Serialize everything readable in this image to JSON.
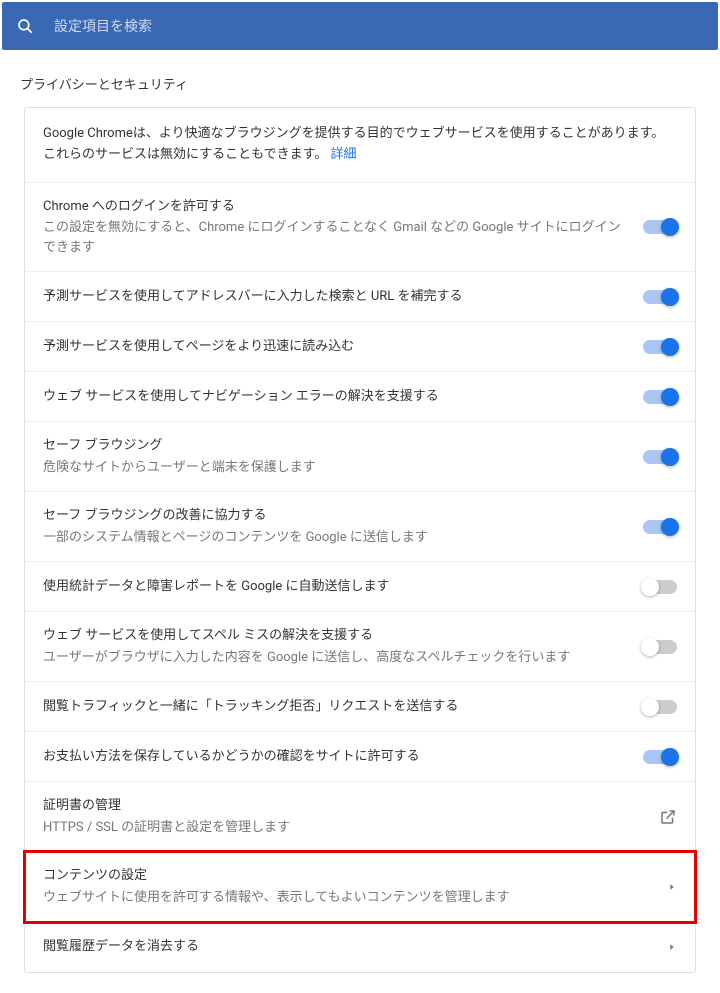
{
  "search": {
    "placeholder": "設定項目を検索"
  },
  "section_title": "プライバシーとセキュリティ",
  "intro": {
    "text": "Google Chromeは、より快適なブラウジングを提供する目的でウェブサービスを使用することがあります。これらのサービスは無効にすることもできます。",
    "link": "詳細"
  },
  "rows": [
    {
      "title": "Chrome へのログインを許可する",
      "sub": "この設定を無効にすると、Chrome にログインすることなく Gmail などの Google サイトにログインできます",
      "toggle": true
    },
    {
      "title": "予測サービスを使用してアドレスバーに入力した検索と URL を補完する",
      "sub": "",
      "toggle": true
    },
    {
      "title": "予測サービスを使用してページをより迅速に読み込む",
      "sub": "",
      "toggle": true
    },
    {
      "title": "ウェブ サービスを使用してナビゲーション エラーの解決を支援する",
      "sub": "",
      "toggle": true
    },
    {
      "title": "セーフ ブラウジング",
      "sub": "危険なサイトからユーザーと端末を保護します",
      "toggle": true
    },
    {
      "title": "セーフ ブラウジングの改善に協力する",
      "sub": "一部のシステム情報とページのコンテンツを Google に送信します",
      "toggle": true
    },
    {
      "title": "使用統計データと障害レポートを Google に自動送信します",
      "sub": "",
      "toggle": false
    },
    {
      "title": "ウェブ サービスを使用してスペル ミスの解決を支援する",
      "sub": "ユーザーがブラウザに入力した内容を Google に送信し、高度なスペルチェックを行います",
      "toggle": false
    },
    {
      "title": "閲覧トラフィックと一緒に「トラッキング拒否」リクエストを送信する",
      "sub": "",
      "toggle": false
    },
    {
      "title": "お支払い方法を保存しているかどうかの確認をサイトに許可する",
      "sub": "",
      "toggle": true
    }
  ],
  "cert": {
    "title": "証明書の管理",
    "sub": "HTTPS / SSL の証明書と設定を管理します"
  },
  "content": {
    "title": "コンテンツの設定",
    "sub": "ウェブサイトに使用を許可する情報や、表示してもよいコンテンツを管理します"
  },
  "clear": {
    "title": "閲覧履歴データを消去する"
  }
}
